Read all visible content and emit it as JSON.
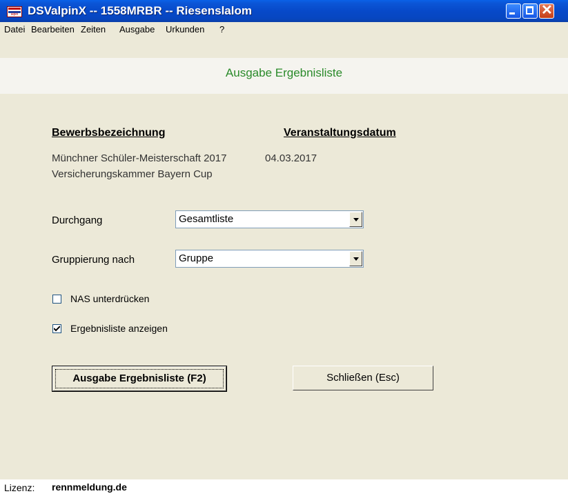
{
  "window": {
    "title": "DSValpinX -- 1558MRBR -- Riesenslalom",
    "icon_label": "alpin",
    "buttons": [
      "minimize",
      "maximize",
      "close"
    ]
  },
  "menu": [
    "Datei",
    "Bearbeiten",
    "Zeiten",
    "Ausgabe",
    "Urkunden",
    "?"
  ],
  "header": {
    "subtitle": "Ausgabe Ergebnisliste"
  },
  "event": {
    "col_name_header": "Bewerbsbezeichnung",
    "col_date_header": "Veranstaltungsdatum",
    "name_line1": "Münchner Schüler-Meisterschaft 2017",
    "name_line2": "Versicherungskammer Bayern Cup",
    "date": "04.03.2017"
  },
  "form": {
    "durchgang_label": "Durchgang",
    "durchgang_value": "Gesamtliste",
    "gruppierung_label": "Gruppierung nach",
    "gruppierung_value": "Gruppe",
    "nas_label": "NAS unterdrücken",
    "nas_checked": false,
    "anzeigen_label": "Ergebnisliste anzeigen",
    "anzeigen_checked": true
  },
  "buttons": {
    "ausgabe": "Ausgabe Ergebnisliste (F2)",
    "schliessen": "Schließen (Esc)"
  },
  "status": {
    "lizenz_label": "Lizenz:",
    "lizenz_value": "rennmeldung.de"
  },
  "colors": {
    "titlebar": "#0749c9",
    "subtitle": "#2a8a2a",
    "background": "#ece9d8"
  }
}
